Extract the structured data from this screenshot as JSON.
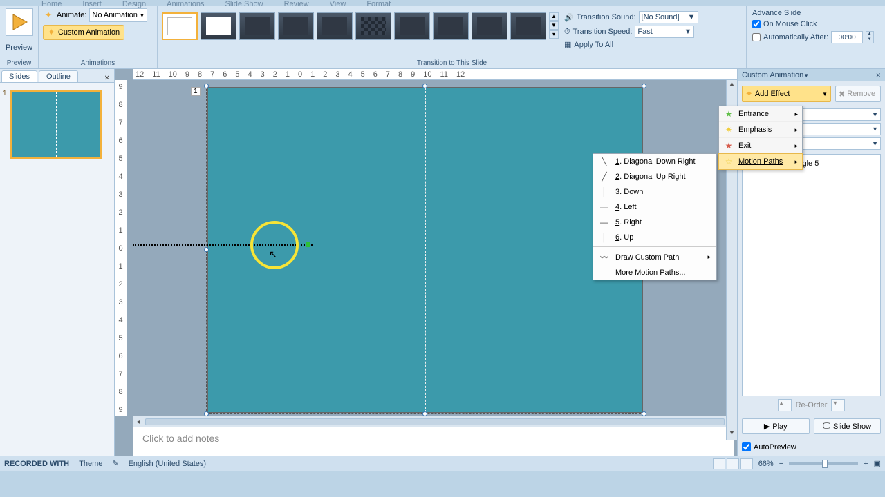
{
  "menu": {
    "tabs": [
      "Home",
      "Insert",
      "Design",
      "Animations",
      "Slide Show",
      "Review",
      "View",
      "Format"
    ]
  },
  "ribbon": {
    "preview": {
      "label": "Preview",
      "group": "Preview"
    },
    "anim": {
      "animate_label": "Animate:",
      "animate_value": "No Animation",
      "custom_label": "Custom Animation",
      "group": "Animations"
    },
    "trans": {
      "sound_label": "Transition Sound:",
      "sound_value": "[No Sound]",
      "speed_label": "Transition Speed:",
      "speed_value": "Fast",
      "apply_all": "Apply To All",
      "group": "Transition to This Slide"
    },
    "advance": {
      "title": "Advance Slide",
      "on_click": "On Mouse Click",
      "auto_after": "Automatically After:",
      "auto_value": "00:00"
    }
  },
  "slides_panel": {
    "tab_slides": "Slides",
    "tab_outline": "Outline",
    "thumb_index": "1"
  },
  "editor": {
    "tag": "1",
    "notes_placeholder": "Click to add notes",
    "h_ticks": [
      "12",
      "11",
      "10",
      "9",
      "8",
      "7",
      "6",
      "5",
      "4",
      "3",
      "2",
      "1",
      "0",
      "1",
      "2",
      "3",
      "4",
      "5",
      "6",
      "7",
      "8",
      "9",
      "10",
      "11",
      "12"
    ],
    "v_ticks": [
      "9",
      "8",
      "7",
      "6",
      "5",
      "4",
      "3",
      "2",
      "1",
      "0",
      "1",
      "2",
      "3",
      "4",
      "5",
      "6",
      "7",
      "8",
      "9"
    ]
  },
  "ca": {
    "title": "Custom Animation",
    "add_effect": "Add Effect",
    "remove": "Remove",
    "reorder": "Re-Order",
    "play": "Play",
    "slideshow": "Slide Show",
    "autopreview": "AutoPreview",
    "item": {
      "index": "1",
      "label": "Rectangle 5"
    }
  },
  "effect_menu": {
    "items": [
      {
        "label": "Entrance",
        "icon": "★",
        "cls": "g"
      },
      {
        "label": "Emphasis",
        "icon": "✷",
        "cls": "y"
      },
      {
        "label": "Exit",
        "icon": "★",
        "cls": "r"
      },
      {
        "label": "Motion Paths",
        "icon": "☆",
        "cls": "y"
      }
    ]
  },
  "mp_menu": {
    "items": [
      {
        "n": "1",
        "label": "Diagonal Down Right",
        "icon": "╲"
      },
      {
        "n": "2",
        "label": "Diagonal Up Right",
        "icon": "╱"
      },
      {
        "n": "3",
        "label": "Down",
        "icon": "│"
      },
      {
        "n": "4",
        "label": "Left",
        "icon": "—"
      },
      {
        "n": "5",
        "label": "Right",
        "icon": "—"
      },
      {
        "n": "6",
        "label": "Up",
        "icon": "│"
      }
    ],
    "draw": "Draw Custom Path",
    "more": "More Motion Paths..."
  },
  "status": {
    "recorded": "RECORDED WITH",
    "theme": "Theme",
    "lang": "English (United States)",
    "zoom": "66%"
  }
}
